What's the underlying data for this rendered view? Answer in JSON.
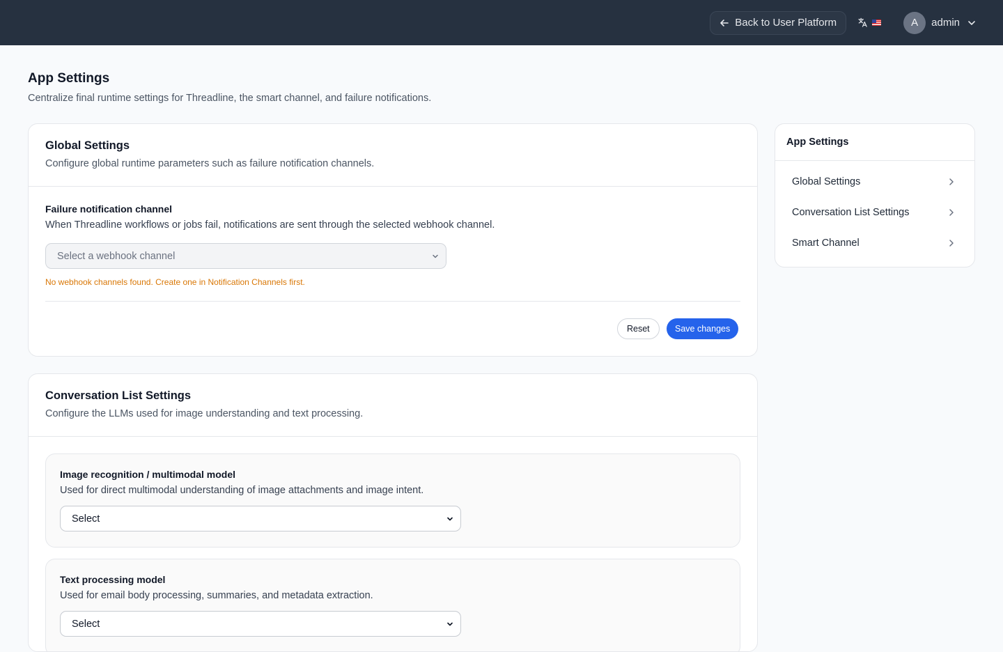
{
  "topbar": {
    "back_label": "Back to User Platform",
    "avatar_letter": "A",
    "username": "admin"
  },
  "page": {
    "title": "App Settings",
    "subtitle": "Centralize final runtime settings for Threadline, the smart channel, and failure notifications."
  },
  "global": {
    "title": "Global Settings",
    "subtitle": "Configure global runtime parameters such as failure notification channels.",
    "field_label": "Failure notification channel",
    "field_desc": "When Threadline workflows or jobs fail, notifications are sent through the selected webhook channel.",
    "select_placeholder": "Select a webhook channel",
    "warning": "No webhook channels found. Create one in Notification Channels first.",
    "reset_label": "Reset",
    "save_label": "Save changes"
  },
  "conversation": {
    "title": "Conversation List Settings",
    "subtitle": "Configure the LLMs used for image understanding and text processing.",
    "models": [
      {
        "label": "Image recognition / multimodal model",
        "desc": "Used for direct multimodal understanding of image attachments and image intent.",
        "value": "Select"
      },
      {
        "label": "Text processing model",
        "desc": "Used for email body processing, summaries, and metadata extraction.",
        "value": "Select"
      }
    ]
  },
  "sidebar": {
    "title": "App Settings",
    "items": [
      {
        "label": "Global Settings"
      },
      {
        "label": "Conversation List Settings"
      },
      {
        "label": "Smart Channel"
      }
    ]
  },
  "colors": {
    "topbar": "#263140",
    "primary": "#2563eb",
    "warning": "#d97706"
  }
}
